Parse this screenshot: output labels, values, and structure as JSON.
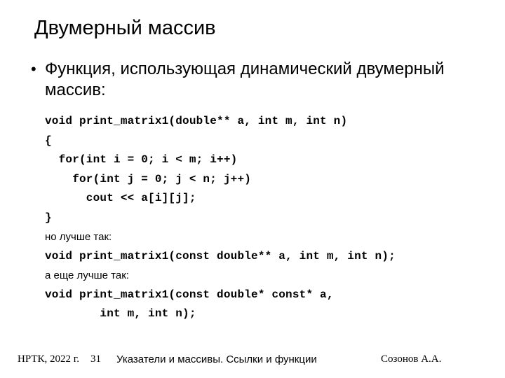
{
  "slide": {
    "title": "Двумерный массив",
    "bullet_marker": "•",
    "bullet_text": "Функция, использующая динамический двумерный массив:",
    "body_lines": [
      {
        "kind": "code",
        "text": "void print_matrix1(double** a, int m, int n)"
      },
      {
        "kind": "code",
        "text": "{"
      },
      {
        "kind": "code",
        "text": "  for(int i = 0; i < m; i++)"
      },
      {
        "kind": "code",
        "text": "    for(int j = 0; j < n; j++)"
      },
      {
        "kind": "code",
        "text": "      cout << a[i][j];"
      },
      {
        "kind": "code",
        "text": "}"
      },
      {
        "kind": "note",
        "text": "но лучше так:"
      },
      {
        "kind": "code",
        "text": "void print_matrix1(const double** a, int m, int n);"
      },
      {
        "kind": "note",
        "text": "а еще лучше так:"
      },
      {
        "kind": "code",
        "text": "void print_matrix1(const double* const* a,"
      },
      {
        "kind": "code",
        "text": "        int m, int n);"
      }
    ]
  },
  "footer": {
    "left": "НРТК, 2022 г.",
    "page_number": "31",
    "center": "Указатели и массивы. Ссылки и функции",
    "right": "Созонов А.А."
  },
  "colors": {
    "background": "#ffffff",
    "text": "#000000"
  }
}
